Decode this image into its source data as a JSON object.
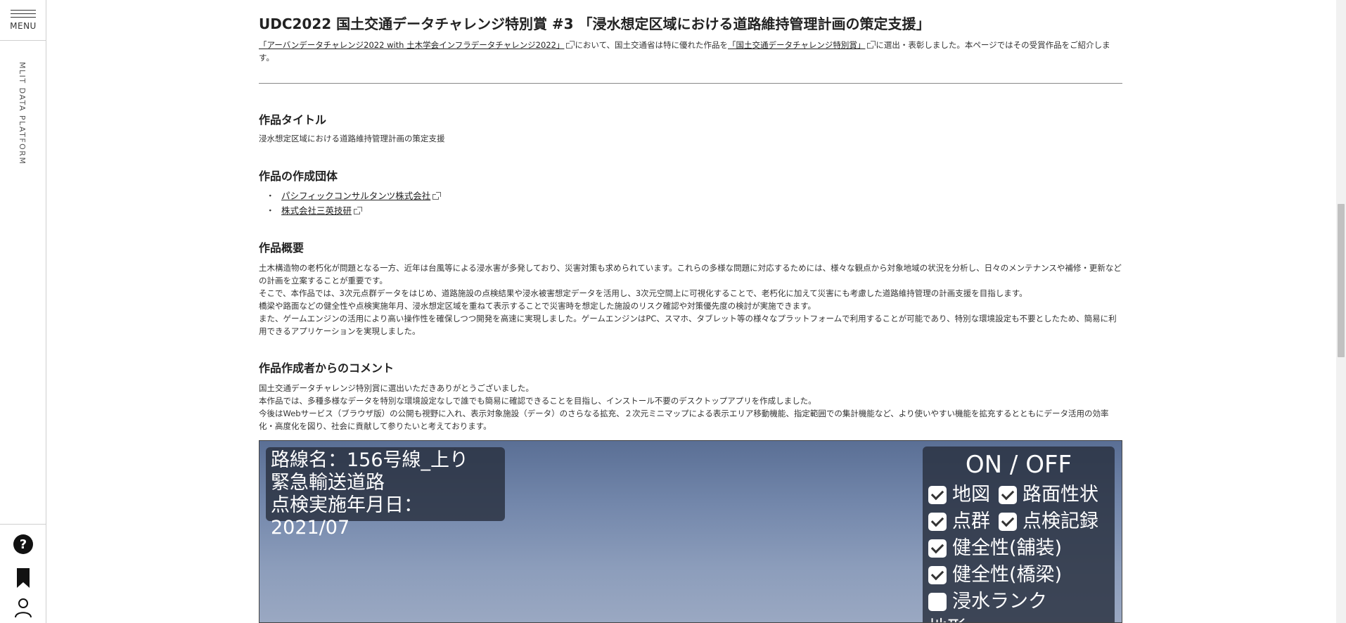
{
  "sidebar": {
    "menu_label": "MENU",
    "brand": "MLIT DATA PLATFORM",
    "icons": [
      "question-circle-icon",
      "bookmark-icon",
      "user-icon"
    ]
  },
  "page": {
    "title": "UDC2022 国土交通データチャレンジ特別賞 #3 「浸水想定区域における道路維持管理計画の策定支援」",
    "intro": {
      "link1": "「アーバンデータチャレンジ2022 with 土木学会インフラデータチャレンジ2022」",
      "text1": "において、国土交通省は特に優れた作品を",
      "link2": "「国土交通データチャレンジ特別賞」",
      "text2": "に選出・表彰しました。本ページではその受賞作品をご紹介します。"
    },
    "sections": {
      "work_title_heading": "作品タイトル",
      "work_title": "浸水想定区域における道路維持管理計画の策定支援",
      "org_heading": "作品の作成団体",
      "orgs": [
        "パシフィックコンサルタンツ株式会社",
        "株式会社三英技研"
      ],
      "summary_heading": "作品概要",
      "summary": [
        "土木構造物の老朽化が問題となる一方、近年は台風等による浸水害が多発しており、災害対策も求められています。これらの多様な問題に対応するためには、様々な観点から対象地域の状況を分析し、日々のメンテナンスや補修・更新などの計画を立案することが重要です。",
        "そこで、本作品では、3次元点群データをはじめ、道路施設の点検結果や浸水被害想定データを活用し、3次元空間上に可視化することで、老朽化に加えて災害にも考慮した道路維持管理の計画支援を目指します。",
        "橋梁や路面などの健全性や点検実施年月、浸水想定区域を重ねて表示することで災害時を想定した施設のリスク確認や対策優先度の検討が実施できます。",
        "また、ゲームエンジンの活用により高い操作性を確保しつつ開発を高速に実現しました。ゲームエンジンはPC、スマホ、タブレット等の様々なプラットフォームで利用することが可能であり、特別な環境設定も不要としたため、簡易に利用できるアプリケーションを実現しました。"
      ],
      "comment_heading": "作品作成者からのコメント",
      "comment": [
        "国土交通データチャレンジ特別賞に選出いただきありがとうございました。",
        "本作品では、多種多様なデータを特別な環境設定なしで誰でも簡易に確認できることを目指し、インストール不要のデスクトップアプリを作成しました。",
        "今後はWebサービス（ブラウザ版）の公開も視野に入れ、表示対象施設（データ）のさらなる拡充、２次元ミニマップによる表示エリア移動機能、指定範囲での集計機能など、より使いやすい機能を拡充するとともにデータ活用の効率化・高度化を図り、社会に貢献して参りたいと考えております。"
      ]
    }
  },
  "screenshot": {
    "info_lines": [
      "路線名：156号線_上り",
      "緊急輸送道路",
      "点検実施年月日：2021/07"
    ],
    "toggle_title": "ON / OFF",
    "toggles": [
      {
        "label": "地図",
        "checked": true
      },
      {
        "label": "路面性状",
        "checked": true
      },
      {
        "label": "点群",
        "checked": true
      },
      {
        "label": "点検記録",
        "checked": true
      },
      {
        "label": "健全性(舗装)",
        "checked": true
      },
      {
        "label": "健全性(橋梁)",
        "checked": true
      },
      {
        "label": "浸水ランク",
        "checked": false
      },
      {
        "label": "地形",
        "checked": false
      }
    ]
  }
}
